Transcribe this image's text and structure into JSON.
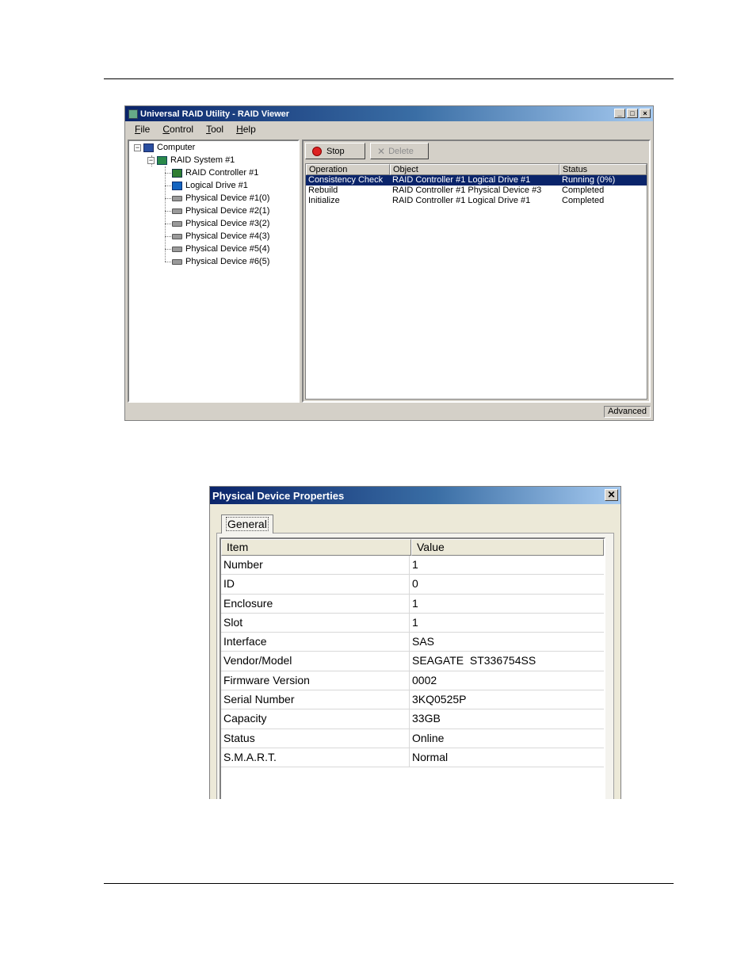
{
  "raid_viewer": {
    "title": "Universal RAID Utility - RAID Viewer",
    "menu": [
      {
        "label": "File",
        "accel": "F",
        "rest": "ile"
      },
      {
        "label": "Control",
        "accel": "C",
        "rest": "ontrol"
      },
      {
        "label": "Tool",
        "accel": "T",
        "rest": "ool"
      },
      {
        "label": "Help",
        "accel": "H",
        "rest": "elp"
      }
    ],
    "tree": {
      "computer": "Computer",
      "raid_system": "RAID System #1",
      "controller": "RAID Controller #1",
      "logical_drive": "Logical Drive #1",
      "physical_devices": [
        "Physical Device #1(0)",
        "Physical Device #2(1)",
        "Physical Device #3(2)",
        "Physical Device #4(3)",
        "Physical Device #5(4)",
        "Physical Device #6(5)"
      ]
    },
    "toolbar": {
      "stop": "Stop",
      "delete": "Delete"
    },
    "operations": {
      "headers": [
        "Operation",
        "Object",
        "Status"
      ],
      "rows": [
        {
          "operation": "Consistency Check",
          "object": "RAID Controller #1  Logical Drive #1",
          "status": "Running (0%)",
          "selected": true
        },
        {
          "operation": "Rebuild",
          "object": "RAID Controller #1  Physical Device #3",
          "status": "Completed",
          "selected": false
        },
        {
          "operation": "Initialize",
          "object": "RAID Controller #1  Logical Drive #1",
          "status": "Completed",
          "selected": false
        }
      ]
    },
    "status_bar": {
      "mode": "Advanced"
    }
  },
  "properties_dialog": {
    "title": "Physical Device Properties",
    "tab": "General",
    "headers": [
      "Item",
      "Value"
    ],
    "rows": [
      [
        "Number",
        "1"
      ],
      [
        "ID",
        "0"
      ],
      [
        "Enclosure",
        "1"
      ],
      [
        "Slot",
        "1"
      ],
      [
        "Interface",
        "SAS"
      ],
      [
        "Vendor/Model",
        "SEAGATE  ST336754SS"
      ],
      [
        "Firmware Version",
        "0002"
      ],
      [
        "Serial Number",
        "3KQ0525P"
      ],
      [
        "Capacity",
        "33GB"
      ],
      [
        "Status",
        "Online"
      ],
      [
        "S.M.A.R.T.",
        "Normal"
      ]
    ]
  }
}
